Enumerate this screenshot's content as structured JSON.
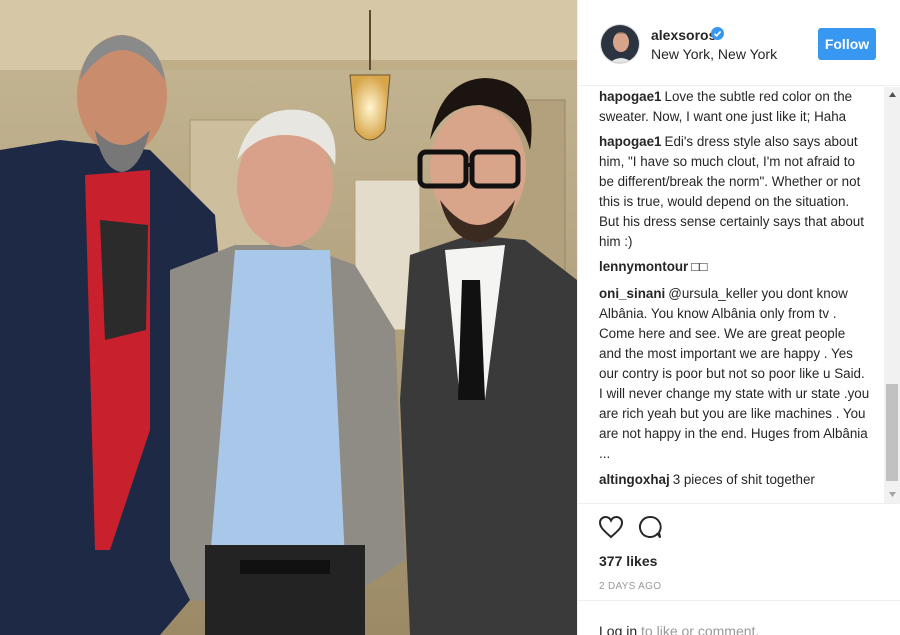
{
  "photo": {
    "subject_icon": "photo-three-men-icon"
  },
  "header": {
    "username": "alexsoros",
    "verified_icon": "verified-badge-icon",
    "location": "New York, New York",
    "follow_label": "Follow",
    "avatar_icon": "profile-avatar-icon"
  },
  "comments": [
    {
      "user": "hapogae1",
      "text": "Love the subtle red color on the sweater. Now, I want one just like it; Haha"
    },
    {
      "user": "hapogae1",
      "text": "Edi's dress style also says about him, \"I have so much clout, I'm not afraid to be different/break the norm\". Whether or not this is true, would depend on the situation. But his dress sense certainly says that about him :)"
    },
    {
      "user": "lennymontour",
      "text": "□□"
    },
    {
      "user": "oni_sinani",
      "text": "@ursula_keller you dont know Albânia. You know Albânia only from tv . Come here and see. We are great people and the most important we are happy . Yes our contry is poor but not so poor like u Said. I will never change my state with ur state .you are rich yeah but you are like machines . You are not happy in the end. Huges from Albânia ..."
    },
    {
      "user": "altingoxhaj",
      "text": "3 pieces of shit together"
    }
  ],
  "actions": {
    "like_icon": "heart-icon",
    "comment_icon": "comment-bubble-icon",
    "likes_text": "377 likes",
    "time_text": "2 DAYS AGO"
  },
  "footer": {
    "login_link": "Log in",
    "login_suffix": " to like or comment.",
    "more_icon": "more-options-icon"
  },
  "colors": {
    "accent": "#3897f0",
    "text": "#262626",
    "muted": "#999999"
  }
}
